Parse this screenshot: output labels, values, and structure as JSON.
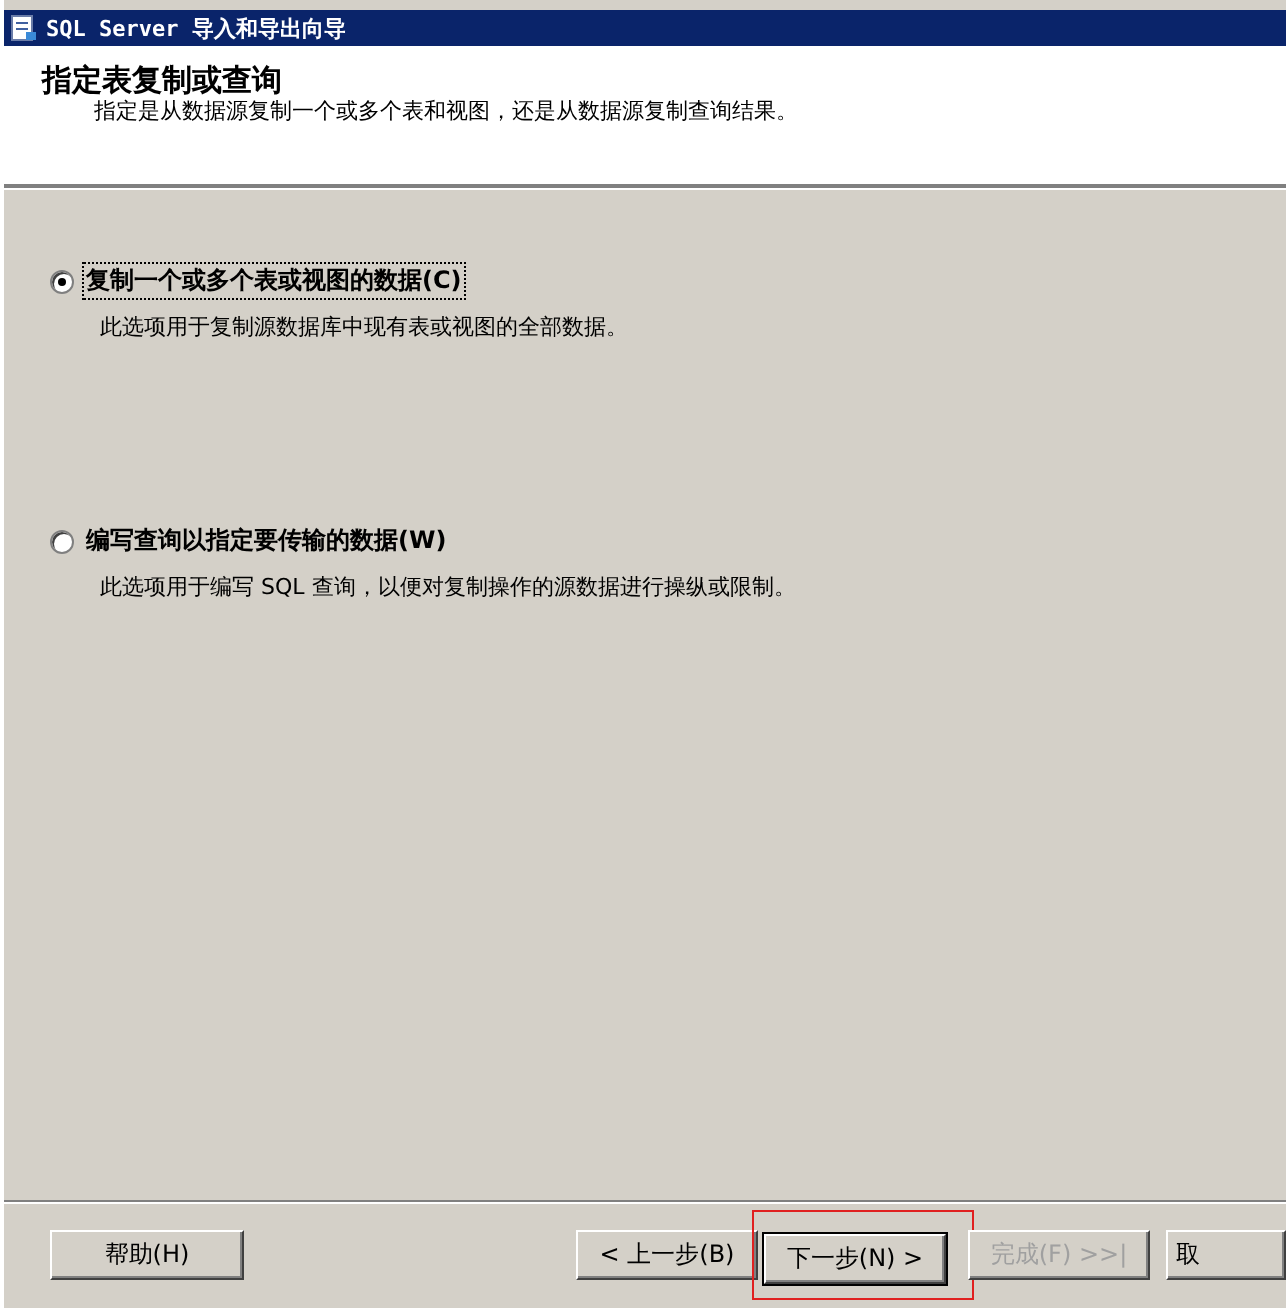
{
  "window": {
    "title": "SQL Server 导入和导出向导"
  },
  "header": {
    "title": "指定表复制或查询",
    "subtitle": "指定是从数据源复制一个或多个表和视图，还是从数据源复制查询结果。"
  },
  "options": [
    {
      "label": "复制一个或多个表或视图的数据(C)",
      "description": "此选项用于复制源数据库中现有表或视图的全部数据。",
      "selected": true
    },
    {
      "label": "编写查询以指定要传输的数据(W)",
      "description": "此选项用于编写 SQL 查询，以便对复制操作的源数据进行操纵或限制。",
      "selected": false
    }
  ],
  "buttons": [
    {
      "kind": "help",
      "label": "帮助(H)",
      "disabled": false,
      "highlighted": false
    },
    {
      "kind": "nav",
      "label": "< 上一步(B)",
      "disabled": false,
      "highlighted": false
    },
    {
      "kind": "nav",
      "label": "下一步(N) >",
      "disabled": false,
      "highlighted": true
    },
    {
      "kind": "nav",
      "label": "完成(F) >>|",
      "disabled": true,
      "highlighted": false
    },
    {
      "kind": "cancel",
      "label": "取",
      "disabled": false,
      "highlighted": false
    }
  ]
}
